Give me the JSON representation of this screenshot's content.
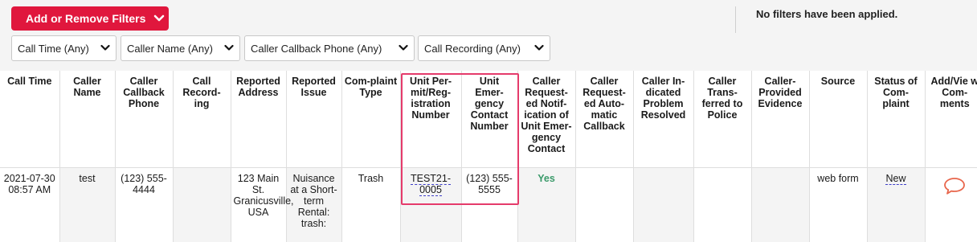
{
  "filters": {
    "add_button_label": "Add or Remove Filters",
    "status_text": "No filters have been applied.",
    "dropdowns": [
      {
        "label": "Call Time (Any)"
      },
      {
        "label": "Caller Name (Any)"
      },
      {
        "label": "Caller Callback Phone (Any)"
      },
      {
        "label": "Call Recording (Any)"
      }
    ]
  },
  "table": {
    "headers": [
      "Call Time",
      "Caller Name",
      "Caller Callback Phone",
      "Call Record-ing",
      "Reported Address",
      "Reported Issue",
      "Com-plaint Type",
      "Unit Per-mit/Reg-istration Number",
      "Unit Emer-gency Contact Number",
      "Caller Request-ed Notif-ication of Unit Emer-gency Contact",
      "Caller Request-ed Auto-matic Callback",
      "Caller In-dicated Problem Resolved",
      "Caller Trans-ferred to Police",
      "Caller-Provided Evidence",
      "Source",
      "Status of Com-plaint",
      "Add/Vie w Com-ments"
    ],
    "row": {
      "call_time": "2021-07-30 08:57 AM",
      "caller_name": "test",
      "callback_phone": "(123) 555-4444",
      "call_recording": "",
      "reported_address": "123 Main St. Granicusville, USA",
      "reported_issue": "Nuisance at a Short-term Rental: trash:",
      "complaint_type": "Trash",
      "unit_permit": "TEST21-0005",
      "emergency_contact": "(123) 555-5555",
      "requested_notification": "Yes",
      "requested_callback": "",
      "problem_resolved": "",
      "transferred_police": "",
      "provided_evidence": "",
      "source": "web form",
      "status": "New",
      "comments_icon": "speech-bubble-icon"
    }
  },
  "colors": {
    "accent_red": "#e0173d",
    "highlight_pink": "#e53b6b",
    "yes_green": "#3b9a6a",
    "comment_icon": "#e8664c"
  }
}
